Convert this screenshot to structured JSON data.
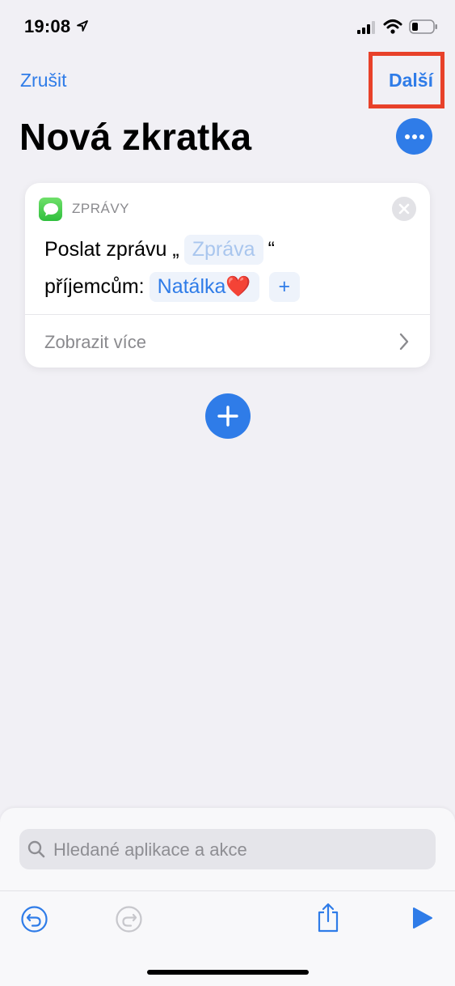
{
  "status_bar": {
    "time": "19:08",
    "icons": [
      "location-arrow-icon",
      "cellular-signal-icon",
      "wifi-icon",
      "battery-icon"
    ]
  },
  "nav": {
    "cancel_label": "Zrušit",
    "next_label": "Další"
  },
  "page": {
    "title": "Nová zkratka",
    "more_icon": "ellipsis-icon"
  },
  "action": {
    "app_name": "ZPRÁVY",
    "text_prefix": "Poslat zprávu „",
    "message_placeholder": "Zpráva",
    "text_quote_close": "“",
    "recipients_label": "příjemcům:",
    "recipient": "Natálka❤️",
    "add_recipient": "+",
    "show_more": "Zobrazit více"
  },
  "bottom": {
    "search_placeholder": "Hledané aplikace a akce",
    "toolbar_icons": [
      "undo-icon",
      "redo-icon",
      "share-icon",
      "play-icon"
    ]
  },
  "colors": {
    "accent": "#2f7ce8",
    "background": "#f1f0f5",
    "highlight": "#e8412a"
  }
}
